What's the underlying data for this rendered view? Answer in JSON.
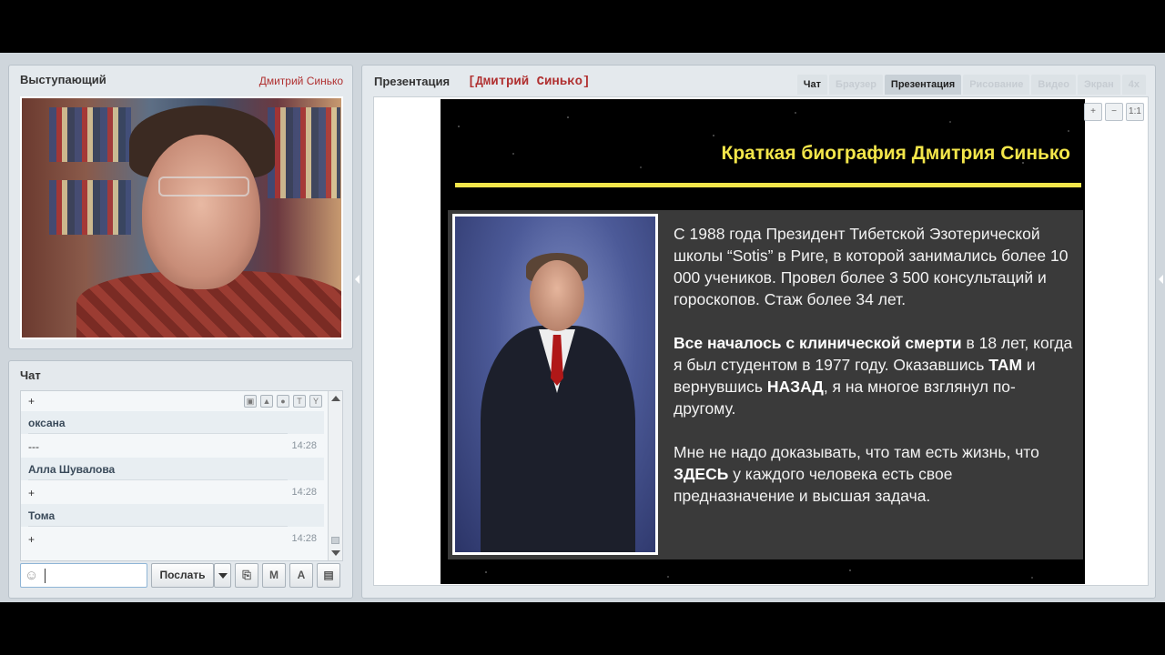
{
  "speaker": {
    "title": "Выступающий",
    "name": "Дмитрий Синько"
  },
  "chat": {
    "title": "Чат",
    "messages": [
      {
        "name": "",
        "text": "+",
        "time": ""
      },
      {
        "name": "оксана",
        "text": "---",
        "time": "14:28"
      },
      {
        "name": "Алла Шувалова",
        "text": "+",
        "time": "14:28"
      },
      {
        "name": "Тома",
        "text": "+",
        "time": "14:28"
      }
    ],
    "send_label": "Послать",
    "format_buttons": [
      "M",
      "A"
    ]
  },
  "presentation": {
    "title": "Презентация",
    "owner": "[Дмитрий Синько]",
    "tabs": [
      {
        "label": "Чат",
        "state": "on"
      },
      {
        "label": "Браузер",
        "state": "disabled"
      },
      {
        "label": "Презентация",
        "state": "active"
      },
      {
        "label": "Рисование",
        "state": "disabled"
      },
      {
        "label": "Видео",
        "state": "disabled"
      },
      {
        "label": "Экран",
        "state": "disabled"
      },
      {
        "label": "4x",
        "state": "disabled"
      }
    ],
    "zoom": [
      "+",
      "−",
      "1:1"
    ]
  },
  "slide": {
    "title": "Краткая биография Дмитрия Синько",
    "para1": "С 1988 года Президент Тибетской Эзотерической школы “Sotis” в Риге, в которой занимались более 10 000 учеников. Провел более 3 500 консультаций и гороскопов. Стаж более 34 лет.",
    "para2_bold": "Все началось с клинической смерти",
    "para2_a": " в 18 лет, когда я был студентом в 1977 году. Оказавшись ",
    "para2_tam": "ТАМ",
    "para2_b": " и  вернувшись ",
    "para2_nazad": "НАЗАД",
    "para2_c": ", я на многое взглянул по-другому.",
    "para3_a": "Мне не надо доказывать, что там есть жизнь, что ",
    "para3_bold": "ЗДЕСЬ",
    "para3_b": " у каждого человека есть свое предназначение и высшая задача."
  }
}
